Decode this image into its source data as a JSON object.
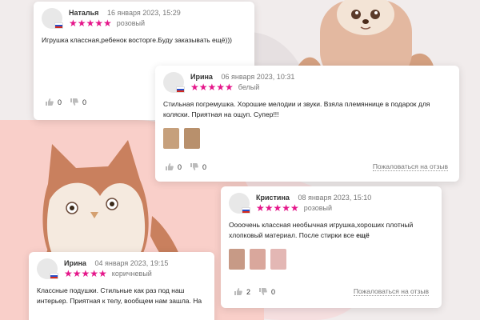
{
  "reviews": [
    {
      "name": "Наталья",
      "date": "16 января 2023, 15:29",
      "stars": "★★★★★",
      "color": "розовый",
      "text": "Игрушка классная,ребенок восторге.Буду заказывать ещё)))",
      "likes": "0",
      "dislikes": "0"
    },
    {
      "name": "Ирина",
      "date": "06 января 2023, 10:31",
      "stars": "★★★★★",
      "color": "белый",
      "text": "Стильная погремушка. Хорошие мелодии и звуки. Взяла племяннице в подарок для коляски. Приятная на ощуп. Супер!!!",
      "likes": "0",
      "dislikes": "0",
      "report": "Пожаловаться на отзыв"
    },
    {
      "name": "Кристина",
      "date": "08 января 2023, 15:10",
      "stars": "★★★★★",
      "color": "розовый",
      "text": "Оооочень классная необычная игрушка,хороших плотный хлопковый материал. После стирки все",
      "more": "ещё",
      "likes": "2",
      "dislikes": "0",
      "report": "Пожаловаться на отзыв"
    },
    {
      "name": "Ирина",
      "date": "04 января 2023, 19:15",
      "stars": "★★★★★",
      "color": "коричневый",
      "text": "Классные подушки. Стильные как раз под наш интерьер. Приятная к телу, вообщем нам зашла. На",
      "likes": "",
      "dislikes": ""
    }
  ],
  "colors": {
    "star": "#e5168a",
    "pink_bg": "#f9cfc9",
    "page_bg": "#f1ecec"
  },
  "icons": {
    "like": "thumbs-up-icon",
    "dislike": "thumbs-down-icon",
    "flag": "russian-flag-icon"
  }
}
